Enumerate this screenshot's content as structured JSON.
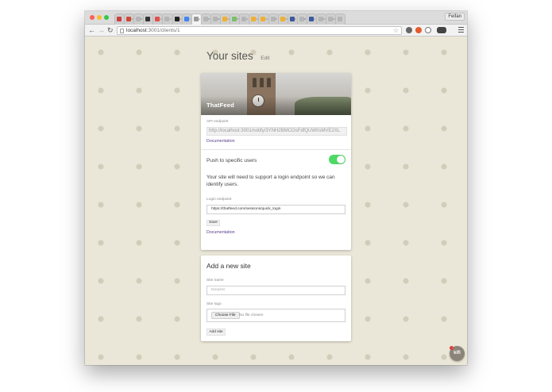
{
  "browser": {
    "tabs": [
      {
        "label": "",
        "color": "#c94040"
      },
      {
        "label": "M",
        "color": "#d14836"
      },
      {
        "label": "B",
        "color": "#b5b5b5"
      },
      {
        "label": "",
        "color": "#333333"
      },
      {
        "label": "iO",
        "color": "#e2504a"
      },
      {
        "label": "H",
        "color": "#b5b5b5"
      },
      {
        "label": "W",
        "color": "#222222"
      },
      {
        "label": "G",
        "color": "#4285f4"
      },
      {
        "label": "pi",
        "color": "#999999"
      },
      {
        "label": "Pi",
        "color": "#b5b5b5"
      },
      {
        "label": "W",
        "color": "#b5b5b5"
      },
      {
        "label": "Cl",
        "color": "#f0b030"
      },
      {
        "label": "Pi",
        "color": "#7bbf6a"
      },
      {
        "label": "A",
        "color": "#b5b5b5"
      },
      {
        "label": "Ci",
        "color": "#f0b030"
      },
      {
        "label": "Cl",
        "color": "#f0b030"
      },
      {
        "label": "Tr",
        "color": "#b5b5b5"
      },
      {
        "label": "Cl",
        "color": "#f0b030"
      },
      {
        "label": "H",
        "color": "#3d5a9e"
      },
      {
        "label": "M",
        "color": "#b5b5b5"
      },
      {
        "label": "H",
        "color": "#3d5a9e"
      },
      {
        "label": "ht",
        "color": "#b5b5b5"
      },
      {
        "label": "ht",
        "color": "#b5b5b5"
      },
      {
        "label": "",
        "color": "#b5b5b5"
      }
    ],
    "active_tab_index": 8,
    "profile_name": "Feifan",
    "url_host": "localhost",
    "url_path": ":3001/clients/1",
    "back_icon": "arrow-left-icon",
    "forward_icon": "arrow-right-icon",
    "reload_icon": "reload-icon"
  },
  "page": {
    "title": "Your sites",
    "edit_label": "Edit",
    "site": {
      "name": "ThatFeed",
      "api_endpoint_label": "API endpoint",
      "api_endpoint_value": "http://localhost:3001/notify/3YNH2BMCOsFdfQUW0sMVE2XL",
      "documentation_label": "Documentation",
      "push_label": "Push to specific users",
      "push_enabled": true,
      "description": "Your site will need to support a login endpoint so we can identify users.",
      "login_endpoint_label": "Login endpoint",
      "login_endpoint_value": "https://thatfeed.com/sessions/quick_login",
      "save_label": "Save",
      "documentation2_label": "Documentation"
    },
    "new_site": {
      "title": "Add a new site",
      "site_name_label": "Site name",
      "site_name_placeholder": "Derpest",
      "site_logo_label": "Site logo",
      "choose_file_label": "Choose File",
      "no_file_label": "No file chosen",
      "add_site_label": "Add site"
    },
    "kifi_label": "kifi"
  },
  "colors": {
    "toggle_on": "#4cd964",
    "link": "#5a3e8c",
    "background": "#ebe7d8"
  }
}
